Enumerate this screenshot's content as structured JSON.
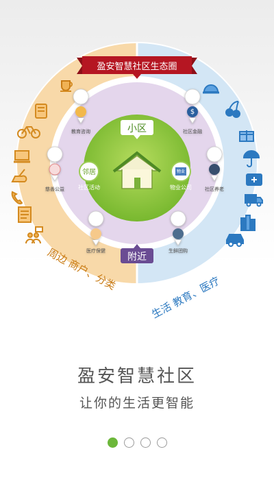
{
  "banner": "盈安智慧社区生态圈",
  "inner": {
    "center_top": "小区",
    "center_bottom": "附近",
    "neighbor_top": "邻居",
    "neighbor_bottom": "社区活动",
    "property": "物业公司"
  },
  "middle_ring": {
    "education": "教育咨询",
    "finance": "社区金融",
    "charity": "慈善公益",
    "elderly": "社区养老",
    "medical": "医疗保健",
    "groupbuy": "生鲜团购",
    "property_badge": "物业"
  },
  "outer_ring": {
    "left_label": "周边 商户、分类",
    "right_label": "生活 教育、医疗"
  },
  "title": "盈安智慧社区",
  "subtitle": "让你的生活更智能",
  "pager": {
    "active_index": 0,
    "count": 4
  },
  "colors": {
    "left_ring": "#f7d7a7",
    "right_ring": "#cfe3f4",
    "purple_ring": "#e2d4ea",
    "green_center": "#8cc63f",
    "banner": "#b51622",
    "dot_active": "#6cb73a"
  }
}
